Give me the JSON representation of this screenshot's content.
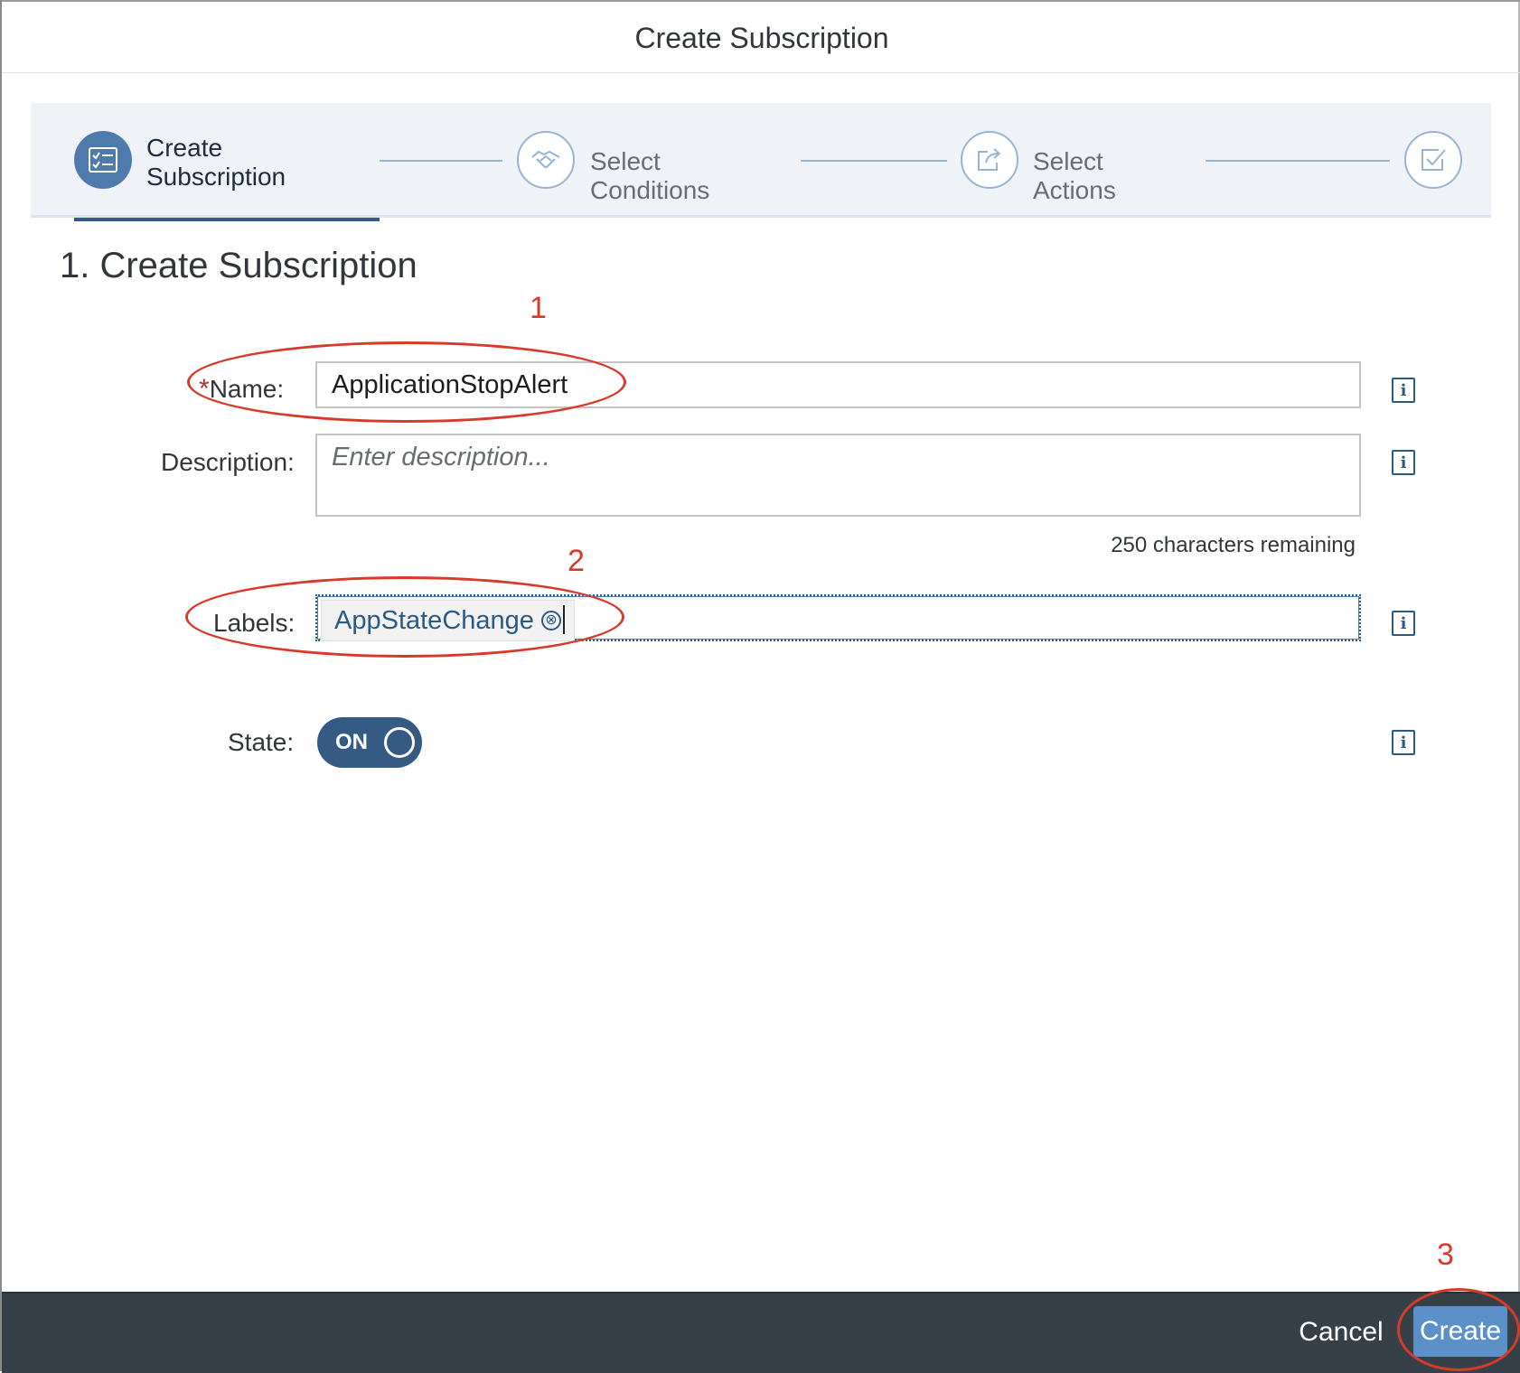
{
  "dialog": {
    "title": "Create Subscription"
  },
  "wizard": {
    "steps": [
      {
        "label": "Create Subscription",
        "label_lines": [
          "Create",
          "Subscription"
        ],
        "icon": "checklist-icon",
        "active": true
      },
      {
        "label": "Select Conditions",
        "icon": "handshake-icon",
        "active": false
      },
      {
        "label": "Select Actions",
        "icon": "share-icon",
        "active": false
      },
      {
        "label": "",
        "icon": "checkbox-icon",
        "active": false
      }
    ]
  },
  "section": {
    "title": "1. Create Subscription"
  },
  "form": {
    "name": {
      "label": "Name:",
      "required_marker": "*",
      "value": "ApplicationStopAlert"
    },
    "description": {
      "label": "Description:",
      "placeholder": "Enter description...",
      "counter": "250 characters remaining"
    },
    "labels": {
      "label": "Labels:",
      "tokens": [
        "AppStateChange"
      ],
      "remove_glyph": "⊗"
    },
    "state": {
      "label": "State:",
      "toggle_text": "ON",
      "on": true
    },
    "info_glyph": "i"
  },
  "annotations": {
    "numbers": [
      "1",
      "2",
      "3"
    ],
    "color": "#d83a2a"
  },
  "footer": {
    "cancel_label": "Cancel",
    "create_label": "Create"
  },
  "colors": {
    "primary": "#4e7bab",
    "footer_bg": "#354049",
    "emphasized_button": "#5b91c8"
  }
}
